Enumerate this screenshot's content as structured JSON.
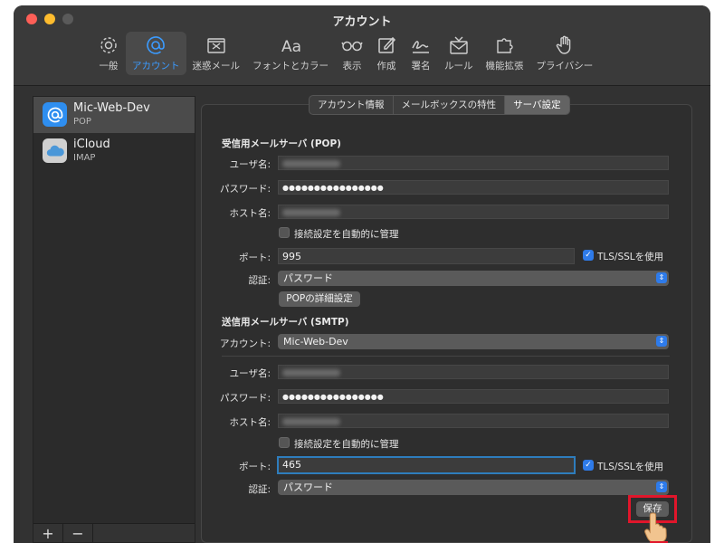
{
  "window": {
    "title": "アカウント"
  },
  "toolbar": {
    "items": [
      {
        "label": "一般",
        "icon": "gear-icon"
      },
      {
        "label": "アカウント",
        "icon": "at-icon"
      },
      {
        "label": "迷惑メール",
        "icon": "junk-icon"
      },
      {
        "label": "フォントとカラー",
        "icon": "font-icon"
      },
      {
        "label": "表示",
        "icon": "glasses-icon"
      },
      {
        "label": "作成",
        "icon": "compose-icon"
      },
      {
        "label": "署名",
        "icon": "signature-icon"
      },
      {
        "label": "ルール",
        "icon": "rules-icon"
      },
      {
        "label": "機能拡張",
        "icon": "puzzle-icon"
      },
      {
        "label": "プライバシー",
        "icon": "hand-icon"
      }
    ]
  },
  "sidebar": {
    "accounts": [
      {
        "name": "Mic-Web-Dev",
        "type": "POP",
        "icon": "at-icon"
      },
      {
        "name": "iCloud",
        "type": "IMAP",
        "icon": "cloud-icon"
      }
    ],
    "add": "+",
    "remove": "−"
  },
  "tabs": [
    "アカウント情報",
    "メールボックスの特性",
    "サーバ設定"
  ],
  "incoming": {
    "title": "受信用メールサーバ (POP)",
    "username_label": "ユーザ名:",
    "password_label": "パスワード:",
    "password": "●●●●●●●●●●●●●●●●",
    "host_label": "ホスト名:",
    "auto_label": "接続設定を自動的に管理",
    "port_label": "ポート:",
    "port": "995",
    "tls_label": "TLS/SSLを使用",
    "auth_label": "認証:",
    "auth": "パスワード",
    "advanced_button": "POPの詳細設定"
  },
  "outgoing": {
    "title": "送信用メールサーバ (SMTP)",
    "account_label": "アカウント:",
    "account": "Mic-Web-Dev",
    "username_label": "ユーザ名:",
    "password_label": "パスワード:",
    "password": "●●●●●●●●●●●●●●●●",
    "host_label": "ホスト名:",
    "auto_label": "接続設定を自動的に管理",
    "port_label": "ポート:",
    "port": "465",
    "tls_label": "TLS/SSLを使用",
    "auth_label": "認証:",
    "auth": "パスワード"
  },
  "save_button": "保存",
  "colors": {
    "accent": "#2e7bea",
    "highlight": "#e0162b",
    "selected_tab": "#3b9bff"
  }
}
